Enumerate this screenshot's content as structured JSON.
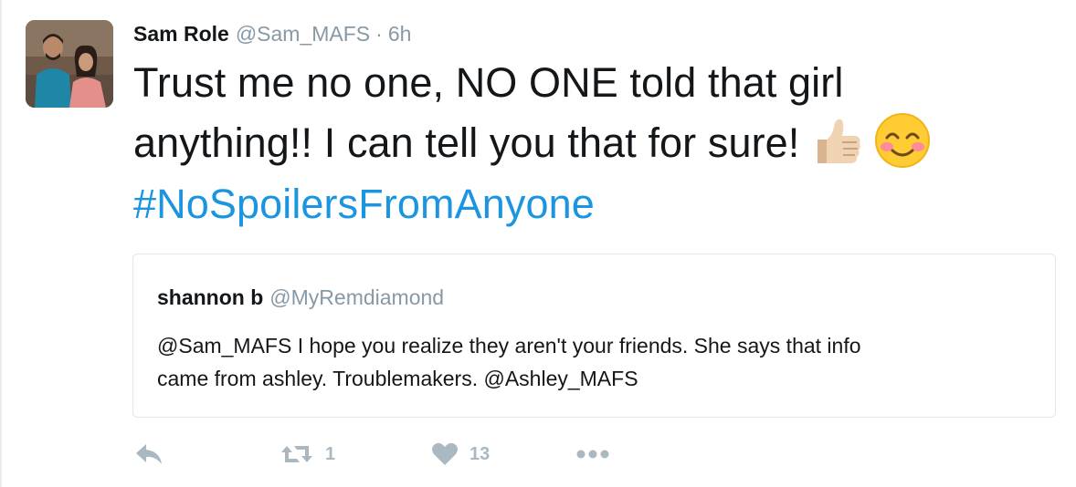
{
  "tweet": {
    "author_name": "Sam Role",
    "author_handle": "@Sam_MAFS",
    "separator": "·",
    "time": "6h",
    "text_line_1": "Trust me no one, NO ONE told that girl",
    "text_line_2": "anything!! I can tell you that for sure!",
    "hashtag": "#NoSpoilersFromAnyone",
    "emojis": [
      "thumbs-up-light-skin-tone",
      "smiling-face-with-smiling-eyes"
    ]
  },
  "quoted_tweet": {
    "author_name": "shannon b",
    "author_handle": "@MyRemdiamond",
    "text_line_1": "@Sam_MAFS  I hope you realize they aren't your friends. She says that info",
    "text_line_2": "came from ashley. Troublemakers. @Ashley_MAFS"
  },
  "actions": {
    "reply_icon": "reply-icon",
    "retweet_icon": "retweet-icon",
    "retweet_count": "1",
    "like_icon": "heart-icon",
    "like_count": "13",
    "more_icon": "more-icon"
  },
  "colors": {
    "text": "#14171a",
    "muted": "#8899a6",
    "hashtag": "#1b95e0",
    "action": "#aab8c2",
    "border": "#e1e8ed"
  }
}
